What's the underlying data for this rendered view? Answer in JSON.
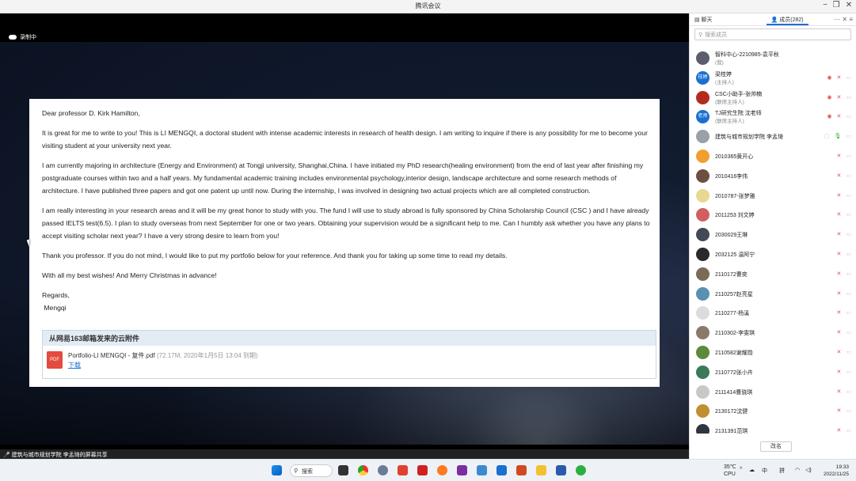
{
  "window": {
    "title": "腾讯会议"
  },
  "recording": {
    "label": "录制中"
  },
  "email": {
    "greeting": "Dear professor D. Kirk Hamilton,",
    "paragraphs": [
      "It is great for me to write to you! This is LI MENGQI,  a doctoral student with intense academic interests in research of health design. I am writing to inquire if there is any possibility for me to become your visiting student at your university next year.",
      "I am currently majoring in architecture (Energy and Environment) at Tongji university, Shanghai,China. I have initiated my PhD research(healing environment) from the end of last year after finishing my postgraduate courses within two and a half years. My fundamental academic training includes environmental psychology,interior design, landscape architecture and some research methods of architecture. I have published three papers and got one patent up until now. During the internship, I was involved in designing two actual projects which are all completed construction.",
      "I am really interesting in your research areas and it will be my great honor to study with you. The fund I will use to study abroad is fully sponsored by China Scholarship Council (CSC ) and I have already passed IELTS test(6.5). I plan to study overseas from next September for one or two years. Obtaining your supervision would be a significant help to me. Can I humbly ask whether you have any plans to accept visiting scholar next year? I have a very strong desire to learn from you!",
      "Thank you professor. If you do not mind, I would like to put my portfolio below for your reference. And thank you for taking up some time to read my details.",
      "With all my best wishes! And Merry Christmas in advance!"
    ],
    "regards": "Regards,",
    "signature": " Mengqi",
    "attachment": {
      "header": "从网易163邮箱发来的云附件",
      "icon_label": "PDF",
      "filename": "Portfolio-LI MENGQI - 复件.pdf",
      "meta": " (72.17M, 2020年1月5日 13:04 到期)",
      "download": "下载"
    }
  },
  "share_bar": {
    "text": "建筑与城市规划学院 李孟琦的屏幕共享"
  },
  "panel": {
    "tab_chat": "聊天",
    "tab_members": "成员(282)",
    "search_placeholder": "搜索成员",
    "rename_button": "改名",
    "members": [
      {
        "name": "智科中心-2210985-袁平秋",
        "role": "(我)",
        "avatar_text": "",
        "color": "#5a5f6b",
        "icons": []
      },
      {
        "name": "梁桂婷",
        "role": "(主持人)",
        "avatar_text": "桂婷",
        "color": "#1a6fd1",
        "icons": [
          "eye",
          "mic",
          "cam"
        ]
      },
      {
        "name": "CSC小助手-张帅楠",
        "role": "(联席主持人)",
        "avatar_text": "",
        "color": "#b42b1e",
        "icons": [
          "eye",
          "mic",
          "cam"
        ]
      },
      {
        "name": "TJ研究生院 沈老师",
        "role": "(联席主持人)",
        "avatar_text": "老师",
        "color": "#1a6fd1",
        "icons": [
          "eye",
          "mic",
          "cam"
        ]
      },
      {
        "name": "建筑与城市规划学院 李孟琦",
        "role": "",
        "avatar_text": "",
        "color": "#9aa0a8",
        "icons": [
          "share",
          "mic-green",
          "cam"
        ]
      },
      {
        "name": "2010365黄开心",
        "role": "",
        "avatar_text": "",
        "color": "#f0a030",
        "icons": [
          "mic",
          "cam"
        ]
      },
      {
        "name": "2010416李伟",
        "role": "",
        "avatar_text": "",
        "color": "#6b5040",
        "icons": [
          "mic",
          "cam"
        ]
      },
      {
        "name": "2010787-张梦雅",
        "role": "",
        "avatar_text": "",
        "color": "#e8d890",
        "icons": [
          "mic",
          "cam"
        ]
      },
      {
        "name": "2011253 刘文婷",
        "role": "",
        "avatar_text": "",
        "color": "#d06060",
        "icons": [
          "mic",
          "cam"
        ]
      },
      {
        "name": "2030029王琳",
        "role": "",
        "avatar_text": "",
        "color": "#444a55",
        "icons": [
          "mic",
          "cam"
        ]
      },
      {
        "name": "2032125 温阿宁",
        "role": "",
        "avatar_text": "",
        "color": "#2a2a2a",
        "icons": [
          "mic",
          "cam"
        ]
      },
      {
        "name": "2110172曹奕",
        "role": "",
        "avatar_text": "",
        "color": "#7a6a58",
        "icons": [
          "mic",
          "cam"
        ]
      },
      {
        "name": "2110257赵亮星",
        "role": "",
        "avatar_text": "",
        "color": "#5a90b0",
        "icons": [
          "mic",
          "cam"
        ]
      },
      {
        "name": "2110277-杨溪",
        "role": "",
        "avatar_text": "",
        "color": "#dcdcdc",
        "icons": [
          "mic",
          "cam"
        ]
      },
      {
        "name": "2110302-李雯琪",
        "role": "",
        "avatar_text": "",
        "color": "#8a7a6a",
        "icons": [
          "mic",
          "cam"
        ]
      },
      {
        "name": "2110582谢耀勋",
        "role": "",
        "avatar_text": "",
        "color": "#5a8a3a",
        "icons": [
          "mic",
          "cam"
        ]
      },
      {
        "name": "2110772张小卉",
        "role": "",
        "avatar_text": "",
        "color": "#3a7a5a",
        "icons": [
          "mic",
          "cam"
        ]
      },
      {
        "name": "2111414曹骁琪",
        "role": "",
        "avatar_text": "",
        "color": "#c8c8c8",
        "icons": [
          "mic",
          "cam"
        ]
      },
      {
        "name": "2130172沈健",
        "role": "",
        "avatar_text": "",
        "color": "#c09030",
        "icons": [
          "mic",
          "cam"
        ]
      },
      {
        "name": "2131391范琪",
        "role": "",
        "avatar_text": "",
        "color": "#303540",
        "icons": [
          "mic",
          "cam"
        ]
      }
    ]
  },
  "taskbar": {
    "search_label": "搜索",
    "weather_temp": "35℃",
    "weather_label": "CPU",
    "ime_lang": "中",
    "ime_mode": "拼",
    "time": "19:33",
    "date": "2022/11/25"
  }
}
